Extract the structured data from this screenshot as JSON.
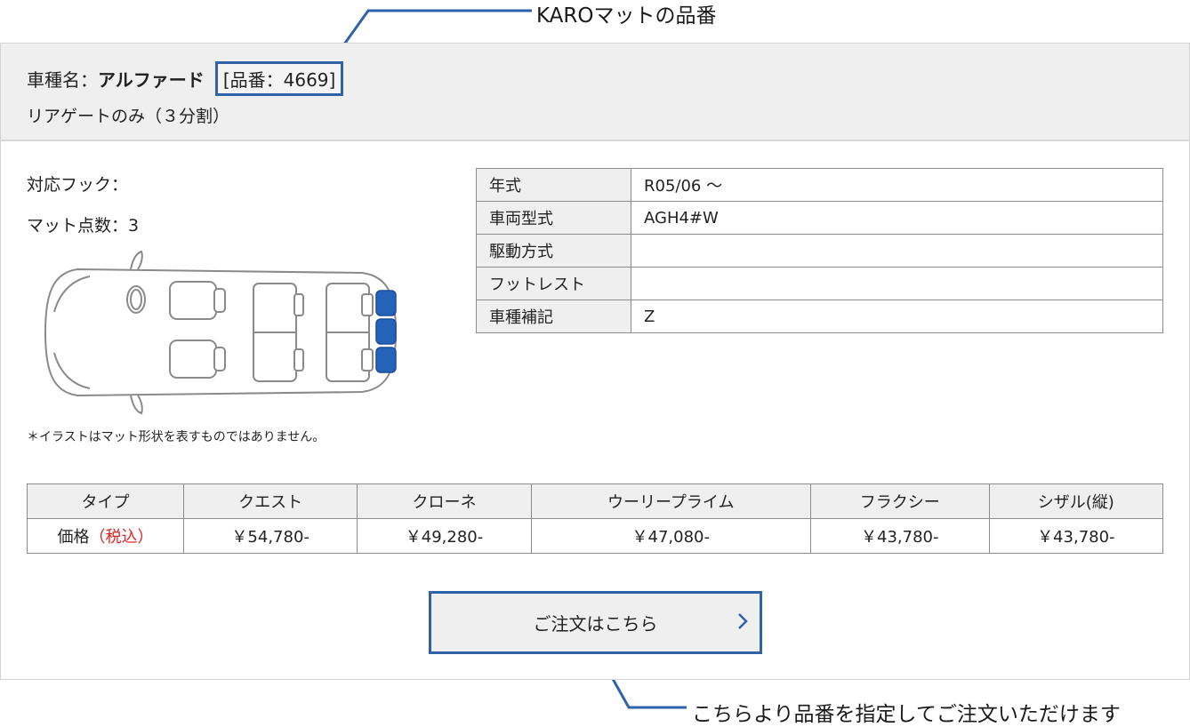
{
  "callouts": {
    "top": "KAROマットの品番",
    "bottom": "こちらより品番を指定してご注文いただけます"
  },
  "header": {
    "prefix": "車種名：",
    "car_name": "アルファード",
    "part_number": "[品番：4669]",
    "subtitle": "リアゲートのみ（３分割）"
  },
  "details": {
    "hook": "対応フック：",
    "mat_count": "マット点数：3",
    "note": "＊イラストはマット形状を表すものではありません。"
  },
  "spec_table": [
    {
      "label": "年式",
      "value": "R05/06 ～"
    },
    {
      "label": "車両型式",
      "value": "AGH4#W"
    },
    {
      "label": "駆動方式",
      "value": ""
    },
    {
      "label": "フットレスト",
      "value": ""
    },
    {
      "label": "車種補記",
      "value": "Z"
    }
  ],
  "price_table": {
    "type_label": "タイプ",
    "price_label": "価格",
    "tax_label": "（税込）",
    "types": [
      "クエスト",
      "クローネ",
      "ウーリープライム",
      "フラクシー",
      "シザル(縦)"
    ],
    "prices": [
      "￥54,780-",
      "￥49,280-",
      "￥47,080-",
      "￥43,780-",
      "￥43,780-"
    ]
  },
  "order_button": {
    "label": "ご注文はこちら"
  },
  "colors": {
    "accent": "#2f62a8",
    "mat_highlight": "#2563b8",
    "tax_red": "#e02222",
    "header_bg": "#efefef"
  },
  "icons": {
    "order_arrow": "chevron-right-icon",
    "car": "car-top-view-icon"
  }
}
